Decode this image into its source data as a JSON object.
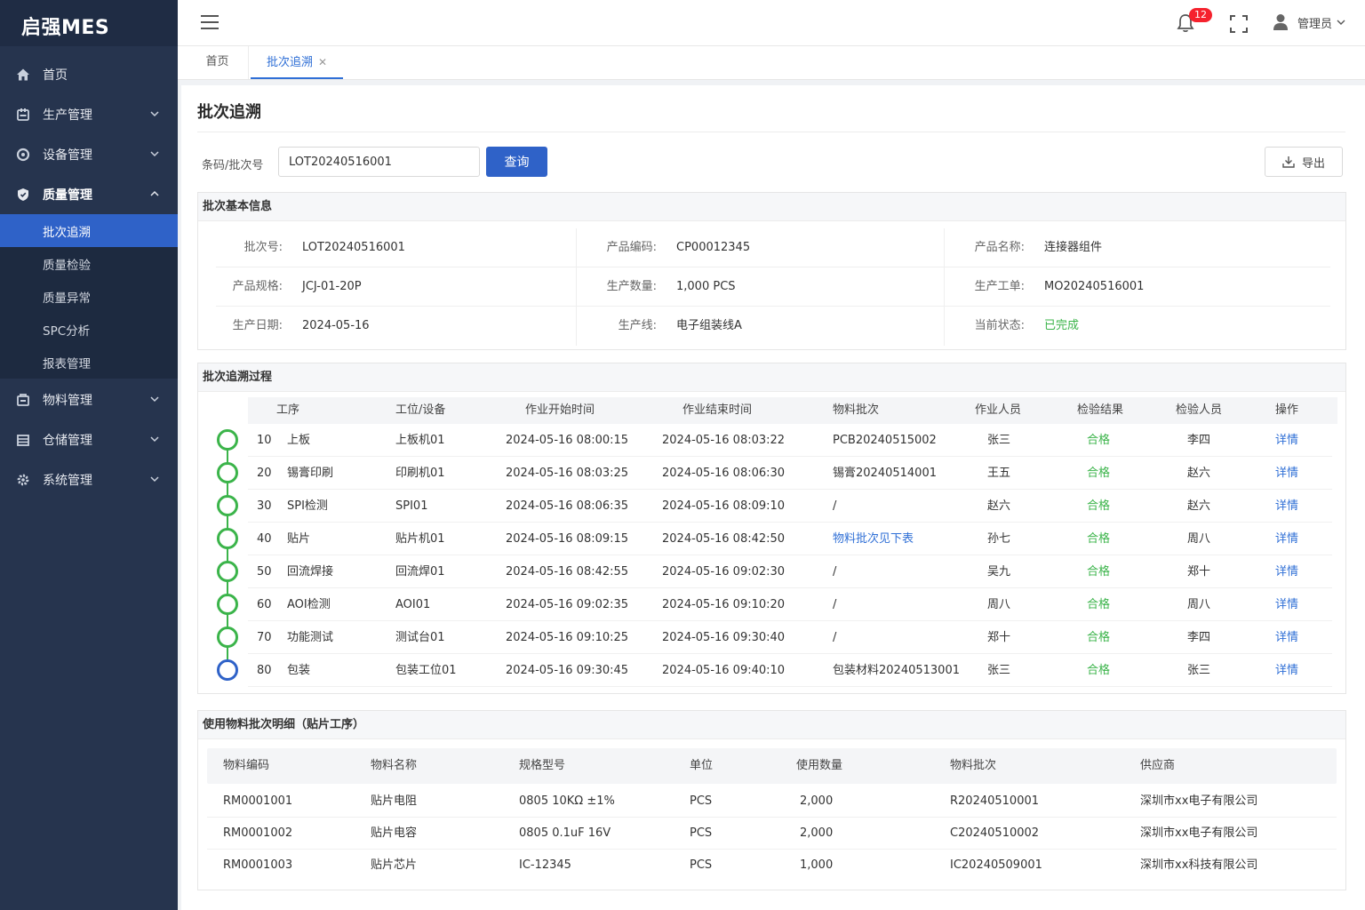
{
  "app": {
    "logo": "启强MES"
  },
  "sidebar": {
    "items": [
      {
        "label": "首页",
        "icon": "home-icon"
      },
      {
        "label": "生产管理",
        "icon": "production-icon"
      },
      {
        "label": "设备管理",
        "icon": "equipment-icon"
      },
      {
        "label": "质量管理",
        "icon": "shield-icon"
      },
      {
        "label": "物料管理",
        "icon": "material-icon"
      },
      {
        "label": "仓储管理",
        "icon": "warehouse-icon"
      },
      {
        "label": "系统管理",
        "icon": "gear-icon"
      }
    ],
    "quality_sub": [
      "批次追溯",
      "质量检验",
      "质量异常",
      "SPC分析",
      "报表管理"
    ]
  },
  "header": {
    "notification_count": "12",
    "user": "管理员"
  },
  "tabs": {
    "home": "首页",
    "current": "批次追溯"
  },
  "page": {
    "title": "批次追溯",
    "query_label": "条码/批次号",
    "query_value": "LOT20240516001",
    "query_button": "查询",
    "export_button": "导出"
  },
  "basic": {
    "title": "批次基本信息",
    "rows": [
      [
        {
          "label": "批次号:",
          "value": "LOT20240516001"
        },
        {
          "label": "产品编码:",
          "value": "CP00012345"
        },
        {
          "label": "产品名称:",
          "value": "连接器组件"
        }
      ],
      [
        {
          "label": "产品规格:",
          "value": "JCJ-01-20P"
        },
        {
          "label": "生产数量:",
          "value": "1,000 PCS"
        },
        {
          "label": "生产工单:",
          "value": "MO20240516001"
        }
      ],
      [
        {
          "label": "生产日期:",
          "value": "2024-05-16"
        },
        {
          "label": "生产线:",
          "value": "电子组装线A"
        },
        {
          "label": "当前状态:",
          "value": "已完成"
        }
      ]
    ]
  },
  "trace": {
    "title": "批次追溯过程",
    "headers": [
      "工序",
      "工位/设备",
      "作业开始时间",
      "作业结束时间",
      "物料批次",
      "作业人员",
      "检验结果",
      "检验人员",
      "操作"
    ],
    "rows": [
      {
        "seq": "10",
        "op": "上板",
        "station": "上板机01",
        "start": "2024-05-16 08:00:15",
        "end": "2024-05-16 08:03:22",
        "batch": "PCB20240515002",
        "worker": "张三",
        "result": "合格",
        "inspector": "李四",
        "action": "详情"
      },
      {
        "seq": "20",
        "op": "锡膏印刷",
        "station": "印刷机01",
        "start": "2024-05-16 08:03:25",
        "end": "2024-05-16 08:06:30",
        "batch": "锡膏20240514001",
        "worker": "王五",
        "result": "合格",
        "inspector": "赵六",
        "action": "详情"
      },
      {
        "seq": "30",
        "op": "SPI检测",
        "station": "SPI01",
        "start": "2024-05-16 08:06:35",
        "end": "2024-05-16 08:09:10",
        "batch": "/",
        "worker": "赵六",
        "result": "合格",
        "inspector": "赵六",
        "action": "详情"
      },
      {
        "seq": "40",
        "op": "贴片",
        "station": "贴片机01",
        "start": "2024-05-16 08:09:15",
        "end": "2024-05-16 08:42:50",
        "batch": "物料批次见下表",
        "worker": "孙七",
        "result": "合格",
        "inspector": "周八",
        "action": "详情"
      },
      {
        "seq": "50",
        "op": "回流焊接",
        "station": "回流焊01",
        "start": "2024-05-16 08:42:55",
        "end": "2024-05-16 09:02:30",
        "batch": "/",
        "worker": "吴九",
        "result": "合格",
        "inspector": "郑十",
        "action": "详情"
      },
      {
        "seq": "60",
        "op": "AOI检测",
        "station": "AOI01",
        "start": "2024-05-16 09:02:35",
        "end": "2024-05-16 09:10:20",
        "batch": "/",
        "worker": "周八",
        "result": "合格",
        "inspector": "周八",
        "action": "详情"
      },
      {
        "seq": "70",
        "op": "功能测试",
        "station": "测试台01",
        "start": "2024-05-16 09:10:25",
        "end": "2024-05-16 09:30:40",
        "batch": "/",
        "worker": "郑十",
        "result": "合格",
        "inspector": "李四",
        "action": "详情"
      },
      {
        "seq": "80",
        "op": "包装",
        "station": "包装工位01",
        "start": "2024-05-16 09:30:45",
        "end": "2024-05-16 09:40:10",
        "batch": "包装材料20240513001",
        "worker": "张三",
        "result": "合格",
        "inspector": "张三",
        "action": "详情"
      }
    ]
  },
  "materials": {
    "title": "使用物料批次明细（贴片工序）",
    "headers": [
      "物料编码",
      "物料名称",
      "规格型号",
      "单位",
      "使用数量",
      "物料批次",
      "供应商"
    ],
    "rows": [
      {
        "code": "RM0001001",
        "name": "贴片电阻",
        "spec": "0805 10KΩ ±1%",
        "unit": "PCS",
        "qty": "2,000",
        "batch": "R20240510001",
        "supplier": "深圳市xx电子有限公司"
      },
      {
        "code": "RM0001002",
        "name": "贴片电容",
        "spec": "0805 0.1uF 16V",
        "unit": "PCS",
        "qty": "2,000",
        "batch": "C20240510002",
        "supplier": "深圳市xx电子有限公司"
      },
      {
        "code": "RM0001003",
        "name": "贴片芯片",
        "spec": "IC-12345",
        "unit": "PCS",
        "qty": "1,000",
        "batch": "IC20240509001",
        "supplier": "深圳市xx科技有限公司"
      }
    ]
  },
  "colors": {
    "sidebar_bg": "#26344e",
    "accent": "#2f62c8",
    "pass": "#3bb44a",
    "link": "#2f6fd6",
    "badge": "#f5222d"
  }
}
